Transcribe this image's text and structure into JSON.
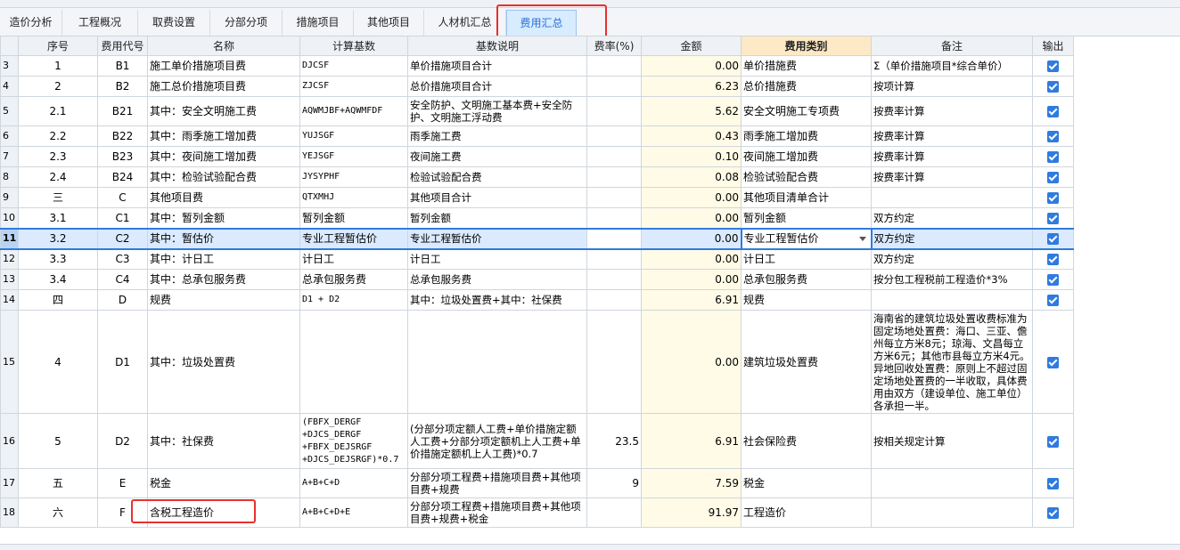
{
  "tabs": [
    "造价分析",
    "工程概况",
    "取费设置",
    "分部分项",
    "措施项目",
    "其他项目",
    "人材机汇总",
    "费用汇总"
  ],
  "headers": [
    "序号",
    "费用代号",
    "名称",
    "计算基数",
    "基数说明",
    "费率(%)",
    "金额",
    "费用类别",
    "备注",
    "输出"
  ],
  "rows": [
    {
      "rn": "3",
      "seq": "1",
      "code": "B1",
      "name": "施工单价措施项目费",
      "base": "DJCSF",
      "desc": "单价措施项目合计",
      "rate": "",
      "amount": "0.00",
      "category": "单价措施费",
      "remark": "Σ（单价措施项目*综合单价）",
      "out": true
    },
    {
      "rn": "4",
      "seq": "2",
      "code": "B2",
      "name": "施工总价措施项目费",
      "base": "ZJCSF",
      "desc": "总价措施项目合计",
      "rate": "",
      "amount": "6.23",
      "category": "总价措施费",
      "remark": "按项计算",
      "out": true
    },
    {
      "rn": "5",
      "seq": "2.1",
      "code": "B21",
      "name": "其中：安全文明施工费",
      "base": "AQWMJBF+AQWMFDF",
      "desc": "安全防护、文明施工基本费+安全防护、文明施工浮动费",
      "rate": "",
      "amount": "5.62",
      "category": "安全文明施工专项费",
      "remark": "按费率计算",
      "out": true
    },
    {
      "rn": "6",
      "seq": "2.2",
      "code": "B22",
      "name": "其中：雨季施工增加费",
      "base": "YUJSGF",
      "desc": "雨季施工费",
      "rate": "",
      "amount": "0.43",
      "category": "雨季施工增加费",
      "remark": "按费率计算",
      "out": true
    },
    {
      "rn": "7",
      "seq": "2.3",
      "code": "B23",
      "name": "其中：夜间施工增加费",
      "base": "YEJSGF",
      "desc": "夜间施工费",
      "rate": "",
      "amount": "0.10",
      "category": "夜间施工增加费",
      "remark": "按费率计算",
      "out": true
    },
    {
      "rn": "8",
      "seq": "2.4",
      "code": "B24",
      "name": "其中：检验试验配合费",
      "base": "JYSYPHF",
      "desc": "检验试验配合费",
      "rate": "",
      "amount": "0.08",
      "category": "检验试验配合费",
      "remark": "按费率计算",
      "out": true
    },
    {
      "rn": "9",
      "seq": "三",
      "code": "C",
      "name": "其他项目费",
      "base": "QTXMHJ",
      "desc": "其他项目合计",
      "rate": "",
      "amount": "0.00",
      "category": "其他项目清单合计",
      "remark": "",
      "out": true
    },
    {
      "rn": "10",
      "seq": "3.1",
      "code": "C1",
      "name": "其中：暂列金额",
      "base": "暂列金额",
      "desc": "暂列金额",
      "rate": "",
      "amount": "0.00",
      "category": "暂列金额",
      "remark": "双方约定",
      "out": true
    },
    {
      "rn": "11",
      "seq": "3.2",
      "code": "C2",
      "name": "其中：暂估价",
      "base": "专业工程暂估价",
      "desc": "专业工程暂估价",
      "rate": "",
      "amount": "0.00",
      "category": "专业工程暂估价",
      "remark": "双方约定",
      "out": true
    },
    {
      "rn": "12",
      "seq": "3.3",
      "code": "C3",
      "name": "其中：计日工",
      "base": "计日工",
      "desc": "计日工",
      "rate": "",
      "amount": "0.00",
      "category": "计日工",
      "remark": "双方约定",
      "out": true
    },
    {
      "rn": "13",
      "seq": "3.4",
      "code": "C4",
      "name": "其中：总承包服务费",
      "base": "总承包服务费",
      "desc": "总承包服务费",
      "rate": "",
      "amount": "0.00",
      "category": "总承包服务费",
      "remark": "按分包工程税前工程造价*3%",
      "out": true
    },
    {
      "rn": "14",
      "seq": "四",
      "code": "D",
      "name": "规费",
      "base": "D1 + D2",
      "desc": "其中：垃圾处置费+其中：社保费",
      "rate": "",
      "amount": "6.91",
      "category": "规费",
      "remark": "",
      "out": true
    },
    {
      "rn": "15",
      "seq": "4",
      "code": "D1",
      "name": "其中：垃圾处置费",
      "base": "",
      "desc": "",
      "rate": "",
      "amount": "0.00",
      "category": "建筑垃圾处置费",
      "remark": "海南省的建筑垃圾处置收费标准为固定场地处置费：海口、三亚、儋州每立方米8元；琼海、文昌每立方米6元；其他市县每立方米4元。异地回收处置费：原则上不超过固定场地处置费的一半收取，具体费用由双方（建设单位、施工单位）各承担一半。",
      "out": true
    },
    {
      "rn": "16",
      "seq": "5",
      "code": "D2",
      "name": "其中：社保费",
      "base": "(FBFX_DERGF +DJCS_DERGF +FBFX_DEJSRGF +DJCS_DEJSRGF)*0.7",
      "desc": "(分部分项定额人工费+单价措施定额人工费+分部分项定额机上人工费+单价措施定额机上人工费)*0.7",
      "rate": "23.5",
      "amount": "6.91",
      "category": "社会保险费",
      "remark": "按相关规定计算",
      "out": true
    },
    {
      "rn": "17",
      "seq": "五",
      "code": "E",
      "name": "税金",
      "base": "A+B+C+D",
      "desc": "分部分项工程费+措施项目费+其他项目费+规费",
      "rate": "9",
      "amount": "7.59",
      "category": "税金",
      "remark": "",
      "out": true
    },
    {
      "rn": "18",
      "seq": "六",
      "code": "F",
      "name": "含税工程造价",
      "base": "A+B+C+D+E",
      "desc": "分部分项工程费+措施项目费+其他项目费+规费+税金",
      "rate": "",
      "amount": "91.97",
      "category": "工程造价",
      "remark": "",
      "out": true
    }
  ]
}
